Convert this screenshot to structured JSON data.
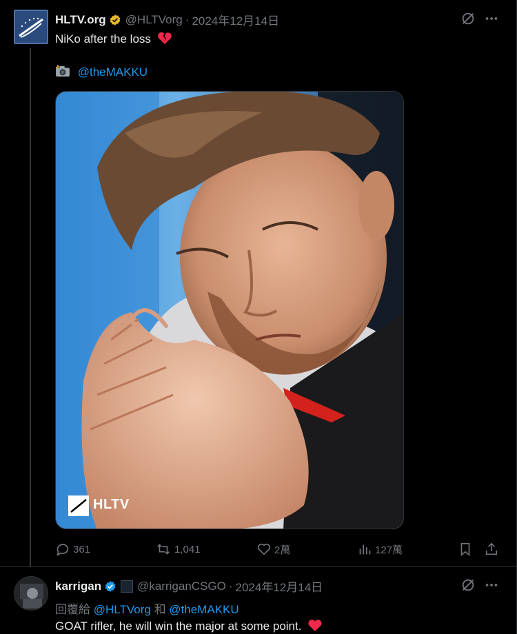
{
  "tweet": {
    "author_name": "HLTV.org",
    "handle": "@HLTVorg",
    "separator": "·",
    "date": "2024年12月14日",
    "text": "NiKo after the loss",
    "photo_credit": "@theMAKKU",
    "watermark": "HLTV",
    "actions": {
      "replies": "361",
      "reposts": "1,041",
      "likes": "2萬",
      "views": "127萬"
    }
  },
  "reply": {
    "author_name": "karrigan",
    "handle": "@karriganCSGO",
    "separator": "·",
    "date": "2024年12月14日",
    "reply_prefix": "回覆給",
    "reply_user1": "@HLTVorg",
    "reply_and": "和",
    "reply_user2": "@theMAKKU",
    "text": "GOAT rifler, he will win the major at some point."
  },
  "colors": {
    "background": "#000000",
    "text": "#e7e9ea",
    "muted": "#71767b",
    "link": "#1d9bf0",
    "verified_gold": "#e8b830",
    "verified_blue": "#1d9bf0",
    "broken_heart": "#f0284a"
  }
}
